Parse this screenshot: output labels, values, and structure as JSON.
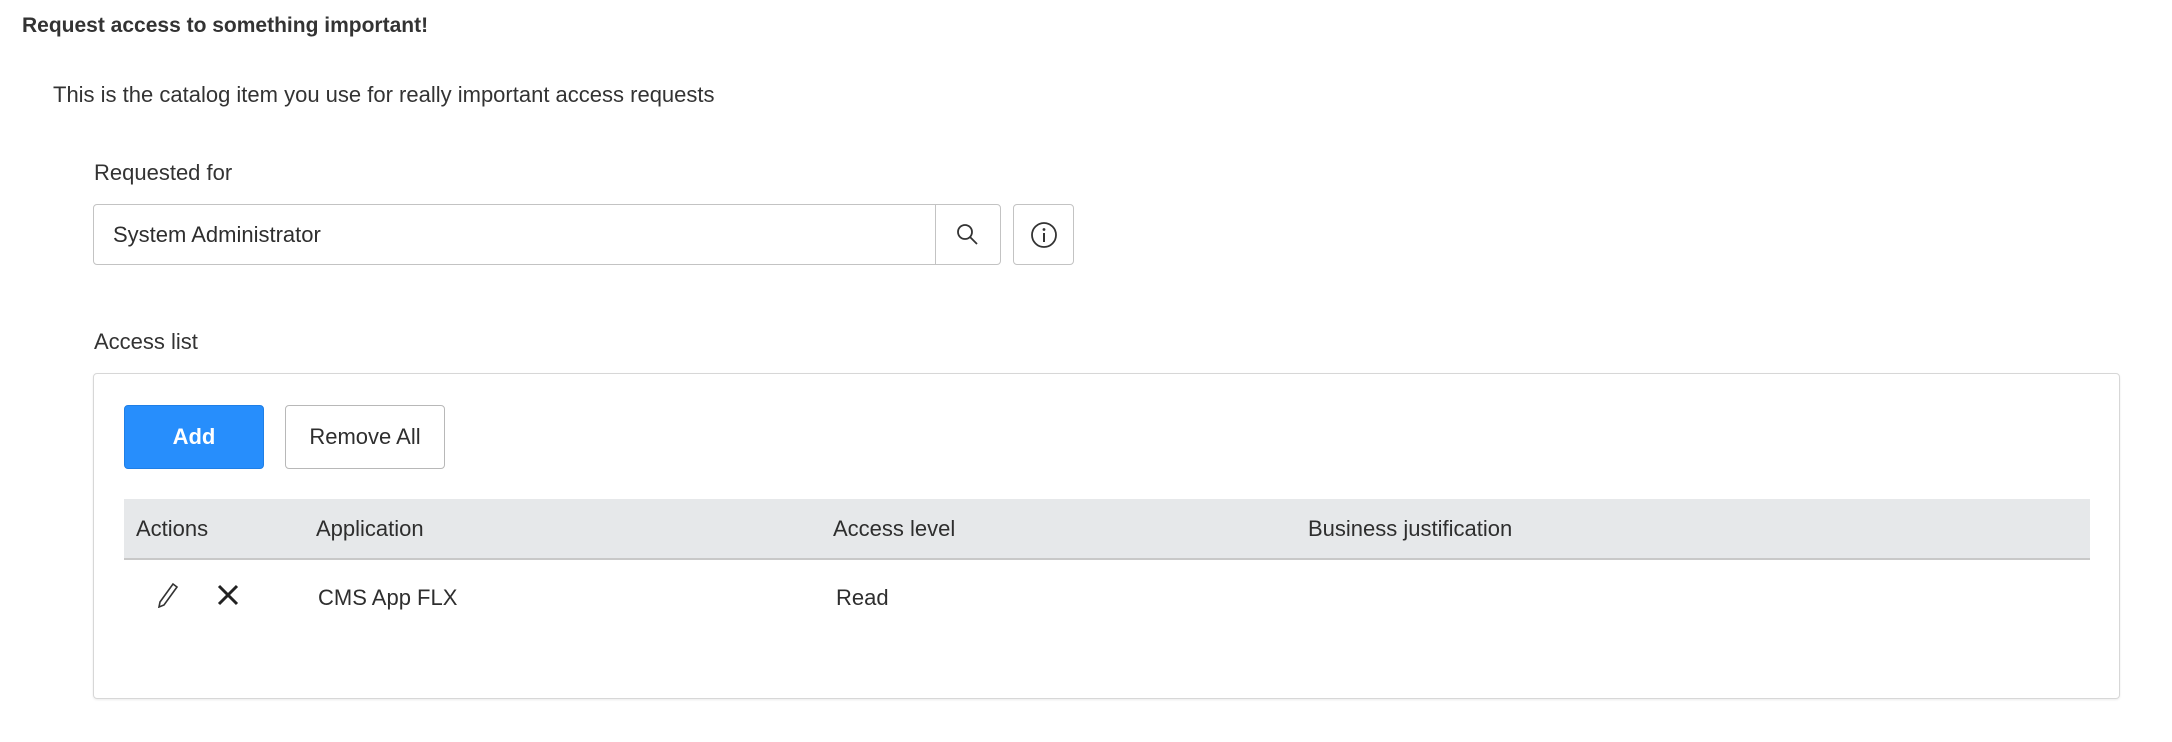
{
  "title": "Request access to something important!",
  "description": "This is the catalog item you use for really important access requests",
  "requested_for": {
    "label": "Requested for",
    "value": "System Administrator"
  },
  "access_list": {
    "label": "Access list",
    "add_label": "Add",
    "remove_all_label": "Remove All",
    "columns": [
      "Actions",
      "Application",
      "Access level",
      "Business justification"
    ],
    "rows": [
      {
        "application": "CMS App FLX",
        "access_level": "Read",
        "business_justification": ""
      }
    ]
  },
  "colors": {
    "primary": "#278efc",
    "header_bg": "#e6e8ea"
  }
}
